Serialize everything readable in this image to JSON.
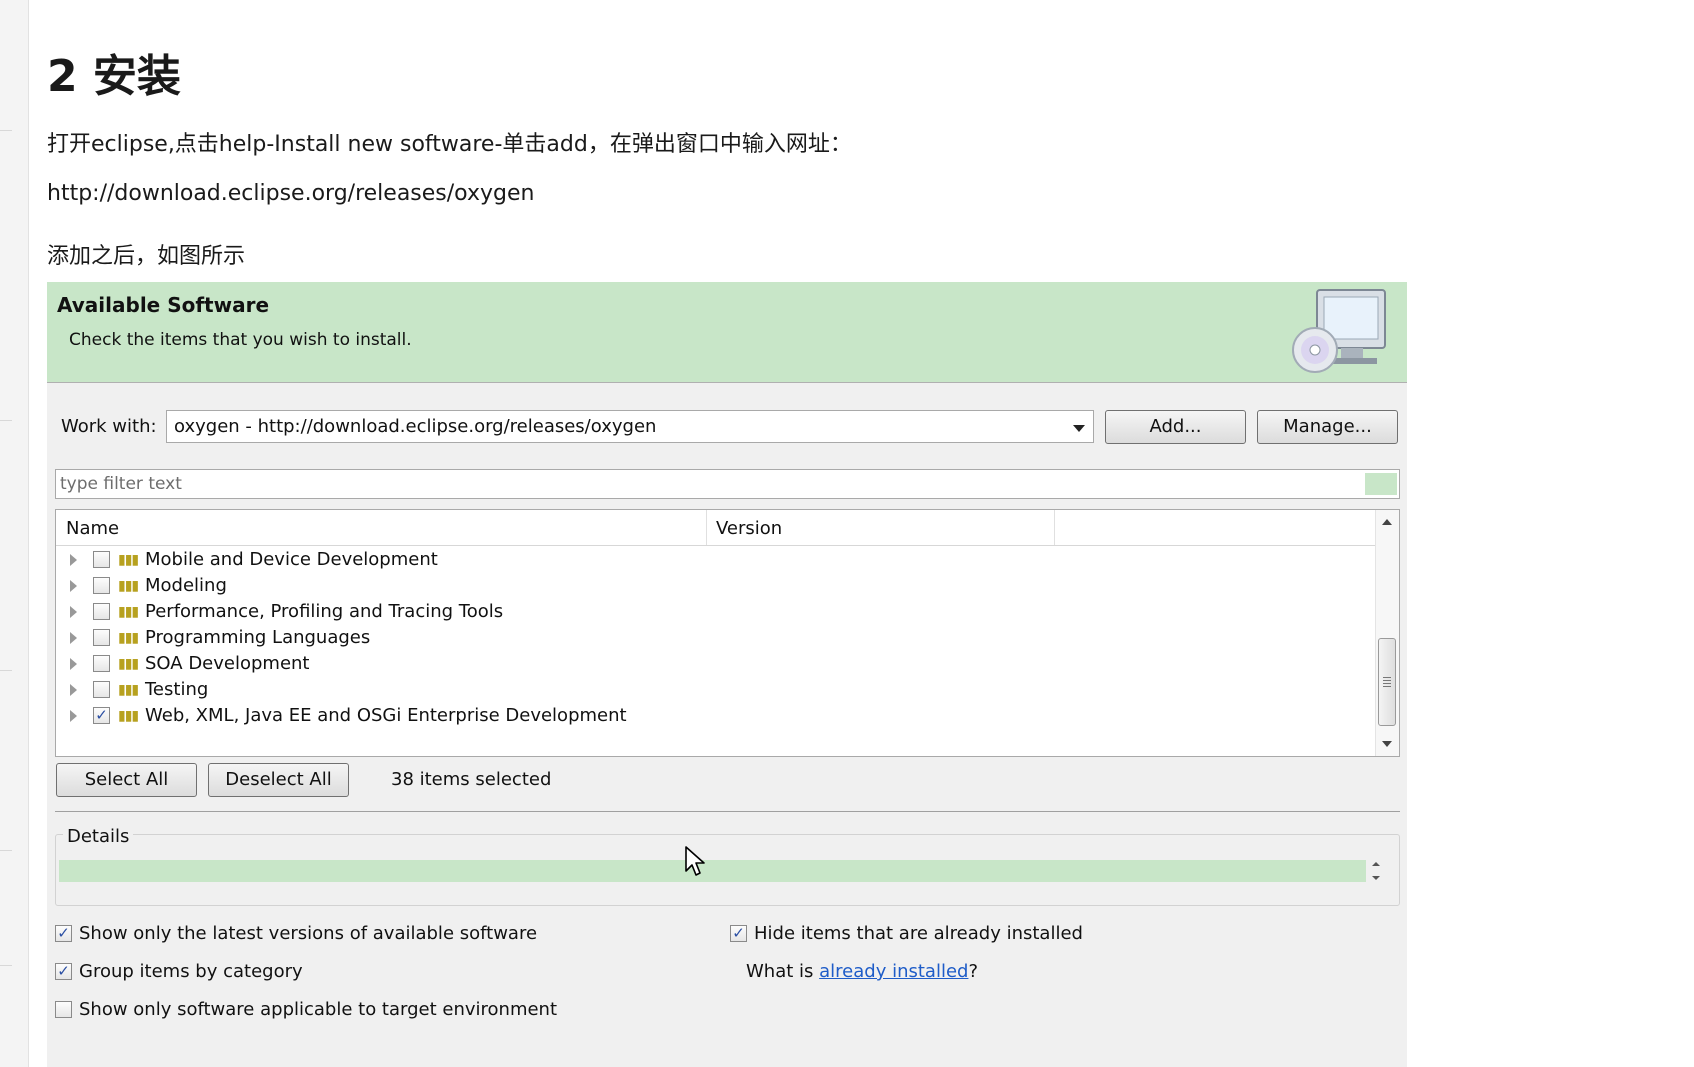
{
  "doc": {
    "heading": "2 安装",
    "para1": "打开eclipse,点击help-Install new software-单击add，在弹出窗口中输入网址：",
    "para2": "http://download.eclipse.org/releases/oxygen",
    "para3": "添加之后，如图所示"
  },
  "dialog": {
    "banner": {
      "title": "Available Software",
      "subtitle": "Check the items that you wish to install.",
      "icon": "computer-cd-icon"
    },
    "work_with": {
      "label": "Work with:",
      "value": "oxygen - http://download.eclipse.org/releases/oxygen",
      "add_label": "Add...",
      "manage_label": "Manage..."
    },
    "filter": {
      "placeholder": "type filter text"
    },
    "tree": {
      "columns": [
        "Name",
        "Version"
      ],
      "items": [
        {
          "label": "Mobile and Device Development",
          "checked": false
        },
        {
          "label": "Modeling",
          "checked": false
        },
        {
          "label": "Performance, Profiling and Tracing Tools",
          "checked": false
        },
        {
          "label": "Programming Languages",
          "checked": false
        },
        {
          "label": "SOA Development",
          "checked": false
        },
        {
          "label": "Testing",
          "checked": false
        },
        {
          "label": "Web, XML, Java EE and OSGi Enterprise Development",
          "checked": true
        }
      ]
    },
    "select_all_label": "Select All",
    "deselect_all_label": "Deselect All",
    "status": "38 items selected",
    "details_label": "Details",
    "options": {
      "latest_versions": {
        "label": "Show only the latest versions of available software",
        "checked": true
      },
      "group_by_category": {
        "label": "Group items by category",
        "checked": true
      },
      "target_env": {
        "label": "Show only software applicable to target environment",
        "checked": false
      },
      "hide_installed": {
        "label": "Hide items that are already installed",
        "checked": true
      },
      "what_is_prefix": "What is ",
      "already_installed_link": "already installed",
      "what_is_suffix": "?"
    }
  },
  "colors": {
    "banner_bg": "#c8e6c8",
    "dialog_bg": "#f0f0f0",
    "link": "#1e5cc8",
    "check": "#2b4fa3"
  }
}
